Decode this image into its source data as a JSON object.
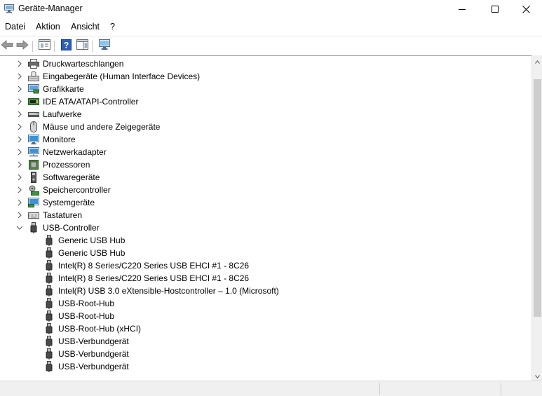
{
  "window": {
    "title": "Geräte-Manager",
    "app_icon": "device-manager-icon",
    "controls": [
      "minimize-icon",
      "maximize-icon",
      "close-icon"
    ]
  },
  "menu": [
    {
      "label": "Datei"
    },
    {
      "label": "Aktion"
    },
    {
      "label": "Ansicht"
    },
    {
      "label": "?"
    }
  ],
  "toolbar": [
    {
      "icon": "back-arrow-icon"
    },
    {
      "icon": "forward-arrow-icon"
    },
    {
      "icon": "properties-icon"
    },
    {
      "icon": "help-icon"
    },
    {
      "icon": "action-pane-icon"
    },
    {
      "icon": "monitor-scan-icon"
    }
  ],
  "tree": {
    "categories": [
      {
        "label": "Druckwarteschlangen",
        "icon": "printer-icon",
        "expanded": false
      },
      {
        "label": "Eingabegeräte (Human Interface Devices)",
        "icon": "hid-icon",
        "expanded": false
      },
      {
        "label": "Grafikkarte",
        "icon": "display-adapter-icon",
        "expanded": false
      },
      {
        "label": "IDE ATA/ATAPI-Controller",
        "icon": "ide-controller-icon",
        "expanded": false
      },
      {
        "label": "Laufwerke",
        "icon": "disk-drive-icon",
        "expanded": false
      },
      {
        "label": "Mäuse und andere Zeigegeräte",
        "icon": "mouse-icon",
        "expanded": false
      },
      {
        "label": "Monitore",
        "icon": "monitor-icon",
        "expanded": false
      },
      {
        "label": "Netzwerkadapter",
        "icon": "network-adapter-icon",
        "expanded": false
      },
      {
        "label": "Prozessoren",
        "icon": "processor-icon",
        "expanded": false
      },
      {
        "label": "Softwaregeräte",
        "icon": "software-device-icon",
        "expanded": false
      },
      {
        "label": "Speichercontroller",
        "icon": "storage-controller-icon",
        "expanded": false
      },
      {
        "label": "Systemgeräte",
        "icon": "system-device-icon",
        "expanded": false
      },
      {
        "label": "Tastaturen",
        "icon": "keyboard-icon",
        "expanded": false
      },
      {
        "label": "USB-Controller",
        "icon": "usb-icon",
        "expanded": true
      }
    ],
    "usb_children": [
      {
        "label": "Generic USB Hub"
      },
      {
        "label": "Generic USB Hub"
      },
      {
        "label": "Intel(R) 8 Series/C220 Series USB EHCI #1 - 8C26"
      },
      {
        "label": "Intel(R) 8 Series/C220 Series USB EHCI #1 - 8C26"
      },
      {
        "label": "Intel(R) USB 3.0 eXtensible-Hostcontroller – 1.0 (Microsoft)"
      },
      {
        "label": "USB-Root-Hub"
      },
      {
        "label": "USB-Root-Hub"
      },
      {
        "label": "USB-Root-Hub (xHCI)"
      },
      {
        "label": "USB-Verbundgerät"
      },
      {
        "label": "USB-Verbundgerät"
      },
      {
        "label": "USB-Verbundgerät"
      }
    ]
  },
  "scrollbar": {
    "position_fraction": 0.2,
    "visible_fraction": 0.78
  }
}
